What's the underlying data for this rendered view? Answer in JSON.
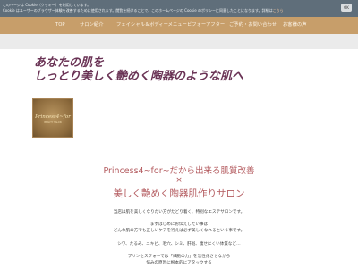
{
  "cookie": {
    "line1": "このページは Cookie（クッキー）を利用しています。",
    "line2": "Cookie はユーザーのブラウザー体験を改善するために使用されます。閲覧を続けることで、このホームページの Cookie のポリシーに同意したことになります。詳細は",
    "link": "こちら",
    "ok_label": "OK"
  },
  "nav": {
    "items": [
      "TOP",
      "サロン紹介",
      "フェイシャル＆ボディーメニュー",
      "ビフォーアフター",
      "ご予約・お問い合わせ",
      "お客様の声"
    ]
  },
  "hero": {
    "line1": "あなたの肌を",
    "line2": "しっとり美しく艶めく陶器のような肌へ"
  },
  "logo": {
    "text": "Princess4~for",
    "sub": "BEAUTY SALON"
  },
  "tagline": {
    "line1": "Princess4~for~だから出来る肌質改善",
    "line2": "×",
    "line3": "美しく艶めく陶器肌作りサロン"
  },
  "body": {
    "line1": "当店は肌を美しくなりたい方がたどり着く、特別なエステサロンです。",
    "line2": "まずはじめにお伝えしたい事は",
    "line3": "どんな肌の方でも正しいケアを行えば必ず美しくなれるという事です。",
    "line4": "シワ、たるみ、ニキビ、毛穴、シミ、肝斑、痩せにくい体質など…",
    "line5": "プリンセスフォーでは「細胞の力」を活性化させながら",
    "line6": "悩みの原因に根本的にアタックする"
  }
}
